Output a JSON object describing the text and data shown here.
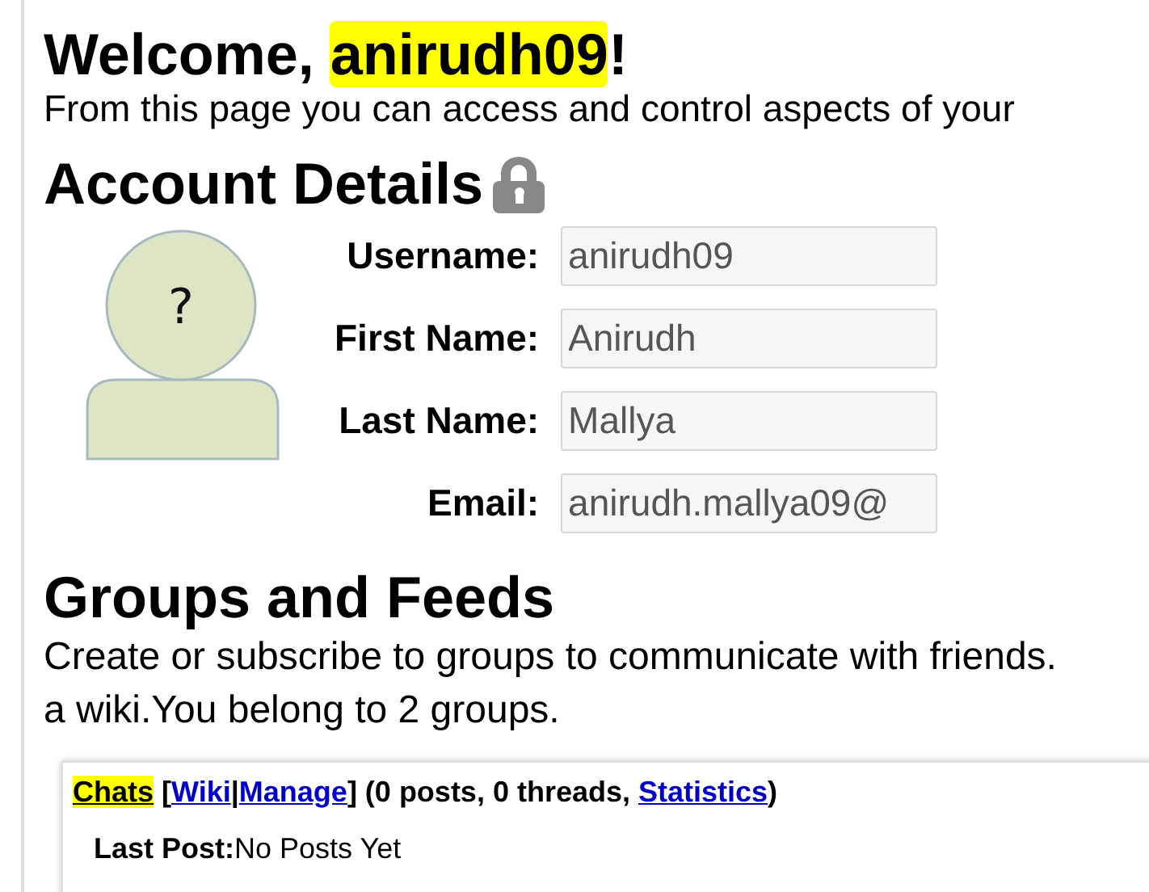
{
  "welcome": {
    "greeting": "Welcome, ",
    "username": "anirudh09",
    "username_highlighted": true,
    "suffix": "!"
  },
  "intro": "From this page you can access and control aspects of your",
  "account": {
    "title": "Account Details",
    "locked": true,
    "avatar_mark": "?",
    "fields": [
      {
        "label": "Username:",
        "value": "anirudh09"
      },
      {
        "label": "First Name:",
        "value": "Anirudh"
      },
      {
        "label": "Last Name:",
        "value": "Mallya"
      },
      {
        "label": "Email:",
        "value": "anirudh.mallya09@"
      }
    ]
  },
  "groups": {
    "title": "Groups and Feeds",
    "lines": [
      "Create or subscribe to groups to communicate with friends.",
      "a wiki.You belong to 2 groups."
    ],
    "items": [
      {
        "header": [
          {
            "kind": "link",
            "text": "Chats",
            "highlighted": true
          },
          {
            "kind": "text",
            "text": " ["
          },
          {
            "kind": "link",
            "text": "Wiki",
            "highlighted": false
          },
          {
            "kind": "text",
            "text": "|"
          },
          {
            "kind": "link",
            "text": "Manage",
            "highlighted": false
          },
          {
            "kind": "text",
            "text": "] (0 posts, 0 threads, "
          },
          {
            "kind": "link",
            "text": "Statistics",
            "highlighted": false
          },
          {
            "kind": "text",
            "text": ")"
          }
        ],
        "last_post_label": "Last Post:",
        "last_post": "No Posts Yet"
      }
    ]
  }
}
